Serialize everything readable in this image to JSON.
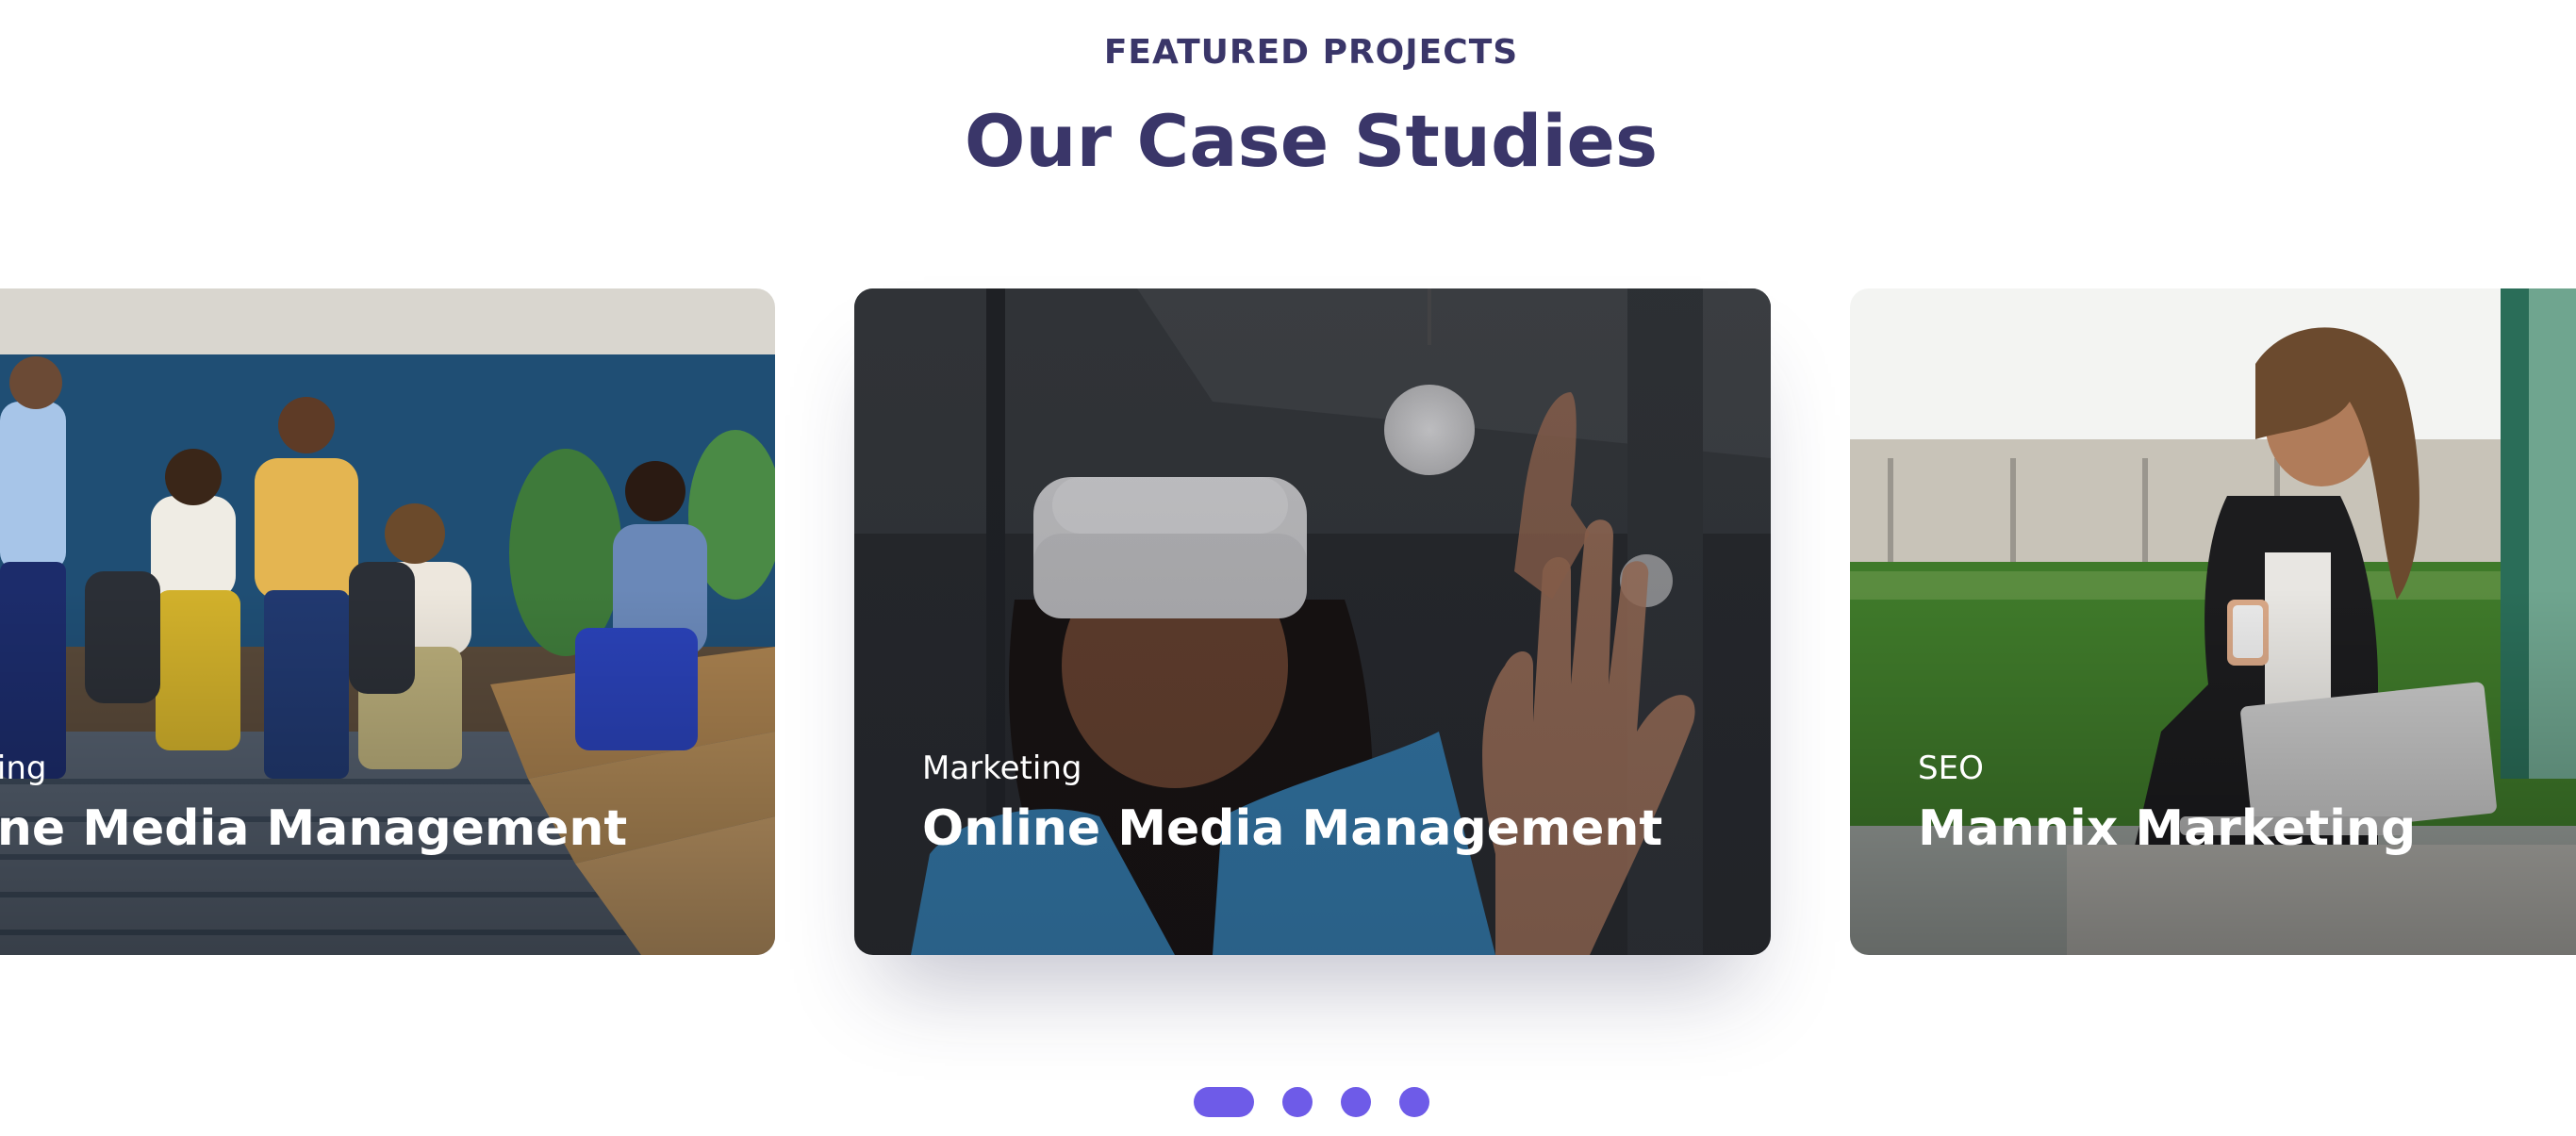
{
  "section": {
    "eyebrow": "FEATURED PROJECTS",
    "title": "Our Case Studies"
  },
  "cards": [
    {
      "category": "Marketing",
      "title": "Online Media Management",
      "image": "team-office-photo"
    },
    {
      "category": "Marketing",
      "title": "Online Media Management",
      "image": "vr-headset-photo"
    },
    {
      "category": "SEO",
      "title": "Mannix Marketing",
      "image": "woman-laptop-park-photo"
    }
  ],
  "pager": {
    "count": 4,
    "active_index": 0
  },
  "colors": {
    "heading": "#3a3669",
    "accent": "#6e5be8",
    "card_text": "#ffffff"
  }
}
